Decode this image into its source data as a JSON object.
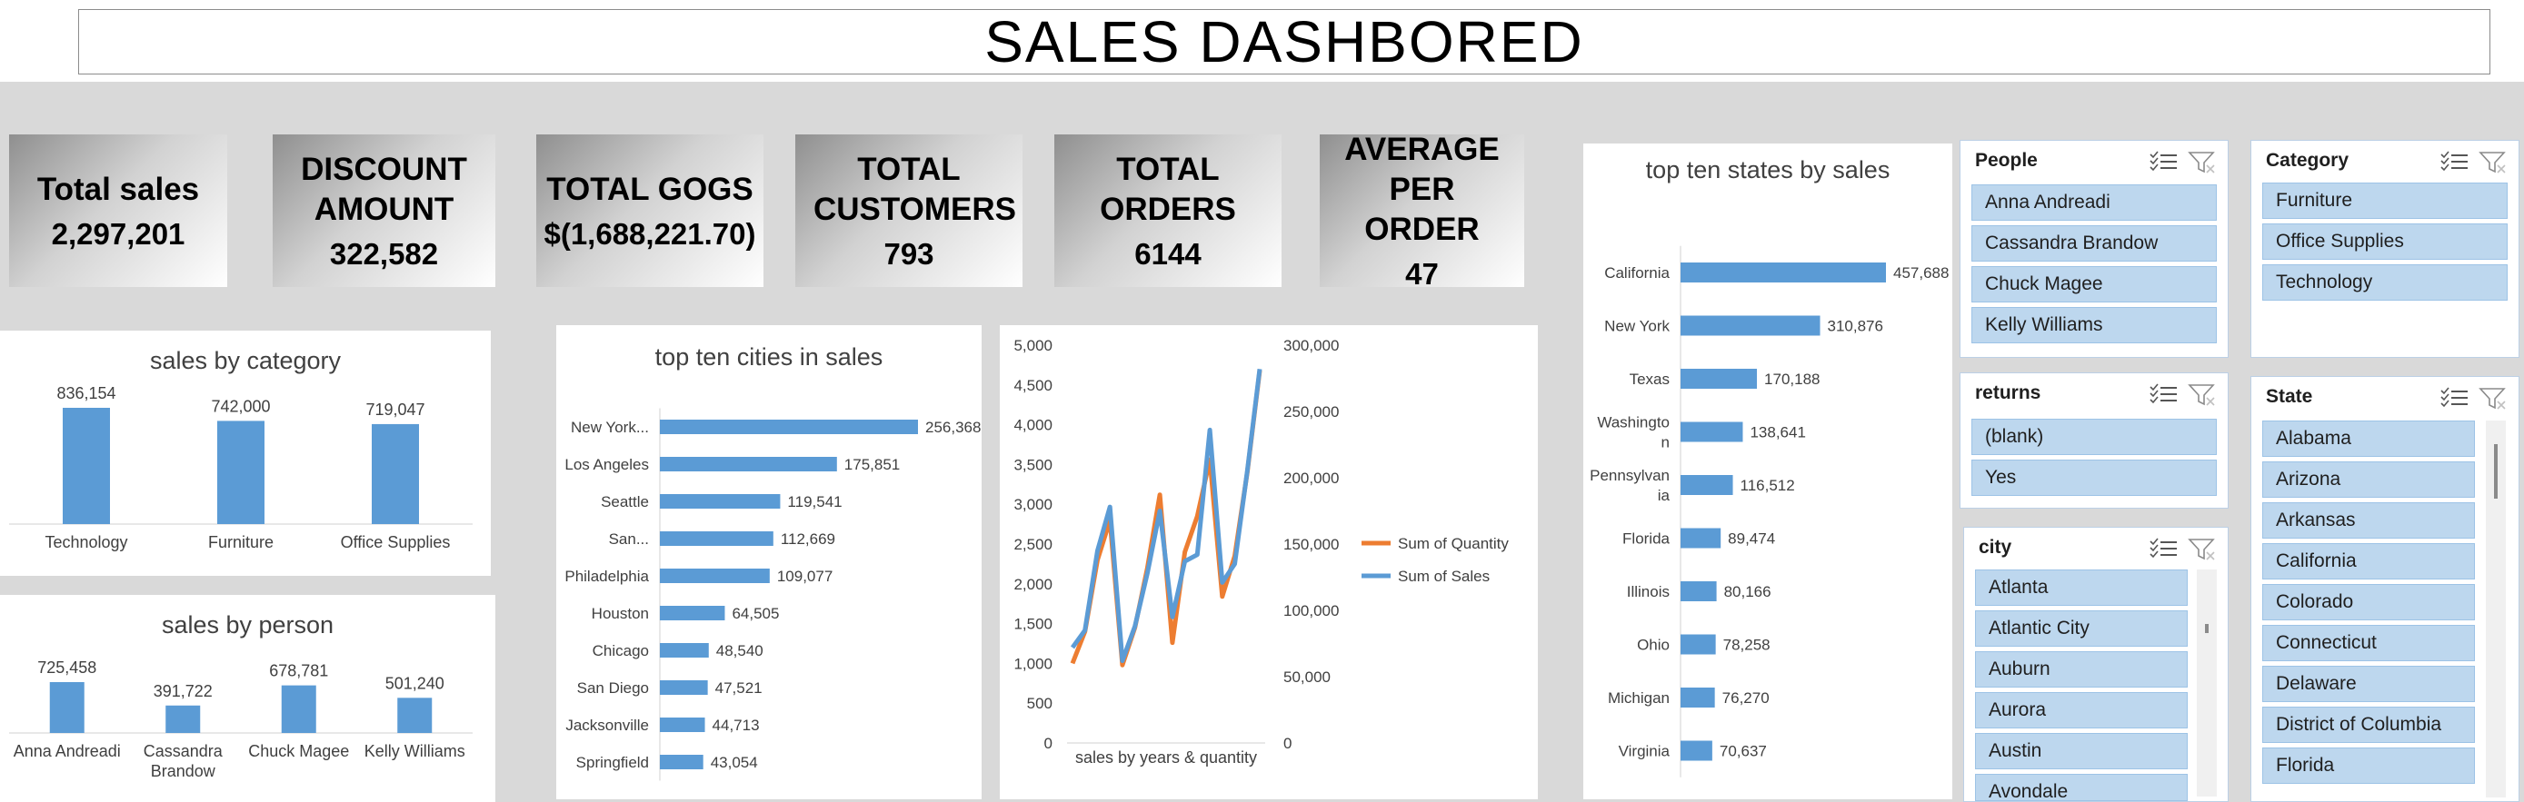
{
  "title": "SALES  DASHBORED",
  "kpis": [
    {
      "label": "Total sales",
      "value": "2,297,201"
    },
    {
      "label": "DISCOUNT AMOUNT",
      "value": "322,582"
    },
    {
      "label": "TOTAL GOGS",
      "value": "$(1,688,221.70)"
    },
    {
      "label": "TOTAL CUSTOMERS",
      "value": "793"
    },
    {
      "label": "TOTAL ORDERS",
      "value": "6144"
    },
    {
      "label": "AVERAGE PER ORDER",
      "value": "47"
    }
  ],
  "colors": {
    "bar": "#5b9bd5",
    "quantity": "#ed7d31",
    "sales": "#5b9bd5",
    "slicer_item": "#bdd7ee"
  },
  "chart_data": [
    {
      "id": "category",
      "type": "bar",
      "title": "sales by category",
      "categories": [
        "Technology",
        "Furniture",
        "Office Supplies"
      ],
      "values": [
        836154,
        742000,
        719047
      ],
      "value_labels": [
        "836,154",
        "742,000",
        "719,047"
      ]
    },
    {
      "id": "person",
      "type": "bar",
      "title": "sales by person",
      "categories": [
        "Anna Andreadi",
        "Cassandra Brandow",
        "Chuck Magee",
        "Kelly Williams"
      ],
      "values": [
        725458,
        391722,
        678781,
        501240
      ],
      "value_labels": [
        "725,458",
        "391,722",
        "678,781",
        "501,240"
      ]
    },
    {
      "id": "cities",
      "type": "bar",
      "orientation": "horizontal",
      "title": "top ten cities in sales",
      "categories": [
        "New York...",
        "Los Angeles",
        "Seattle",
        "San...",
        "Philadelphia",
        "Houston",
        "Chicago",
        "San Diego",
        "Jacksonville",
        "Springfield"
      ],
      "values": [
        256368,
        175851,
        119541,
        112669,
        109077,
        64505,
        48540,
        47521,
        44713,
        43054
      ],
      "value_labels": [
        "256,368",
        "175,851",
        "119,541",
        "112,669",
        "109,077",
        "64,505",
        "48,540",
        "47,521",
        "44,713",
        "43,054"
      ]
    },
    {
      "id": "years",
      "type": "line",
      "xlabel": "sales by years & quantity",
      "y_left_ticks": [
        "0",
        "500",
        "1,000",
        "1,500",
        "2,000",
        "2,500",
        "3,000",
        "3,500",
        "4,000",
        "4,500",
        "5,000"
      ],
      "y_right_ticks": [
        "0",
        "50,000",
        "100,000",
        "150,000",
        "200,000",
        "250,000",
        "300,000"
      ],
      "ylim_left": [
        0,
        5000
      ],
      "ylim_right": [
        0,
        300000
      ],
      "series": [
        {
          "name": "Sum of Quantity",
          "axis": "left",
          "values": [
            1000,
            1400,
            2300,
            2800,
            980,
            1450,
            2200,
            3120,
            1260,
            2400,
            2850,
            3560,
            1840,
            2350,
            3400,
            4680
          ]
        },
        {
          "name": "Sum of Sales",
          "axis": "right",
          "values": [
            72000,
            85000,
            145000,
            178000,
            62000,
            88000,
            128000,
            175000,
            95000,
            137000,
            142000,
            236000,
            121000,
            135000,
            205000,
            282000
          ]
        }
      ]
    },
    {
      "id": "states",
      "type": "bar",
      "orientation": "horizontal",
      "title": "top ten states by sales",
      "categories": [
        "California",
        "New York",
        "Texas",
        "Washingto\nn",
        "Pennsylvan\nia",
        "Florida",
        "Illinois",
        "Ohio",
        "Michigan",
        "Virginia"
      ],
      "values": [
        457688,
        310876,
        170188,
        138641,
        116512,
        89474,
        80166,
        78258,
        76270,
        70637
      ],
      "value_labels": [
        "457,688",
        "310,876",
        "170,188",
        "138,641",
        "116,512",
        "89,474",
        "80,166",
        "78,258",
        "76,270",
        "70,637"
      ]
    }
  ],
  "slicers": {
    "people": {
      "title": "People",
      "items": [
        "Anna Andreadi",
        "Cassandra Brandow",
        "Chuck Magee",
        "Kelly Williams"
      ]
    },
    "category": {
      "title": "Category",
      "items": [
        "Furniture",
        "Office Supplies",
        "Technology"
      ]
    },
    "returns": {
      "title": "returns",
      "items": [
        "(blank)",
        "Yes"
      ]
    },
    "city": {
      "title": "city",
      "items": [
        "Atlanta",
        "Atlantic City",
        "Auburn",
        "Aurora",
        "Austin",
        "Avondale"
      ]
    },
    "state": {
      "title": "State",
      "items": [
        "Alabama",
        "Arizona",
        "Arkansas",
        "California",
        "Colorado",
        "Connecticut",
        "Delaware",
        "District of Columbia",
        "Florida"
      ]
    }
  }
}
